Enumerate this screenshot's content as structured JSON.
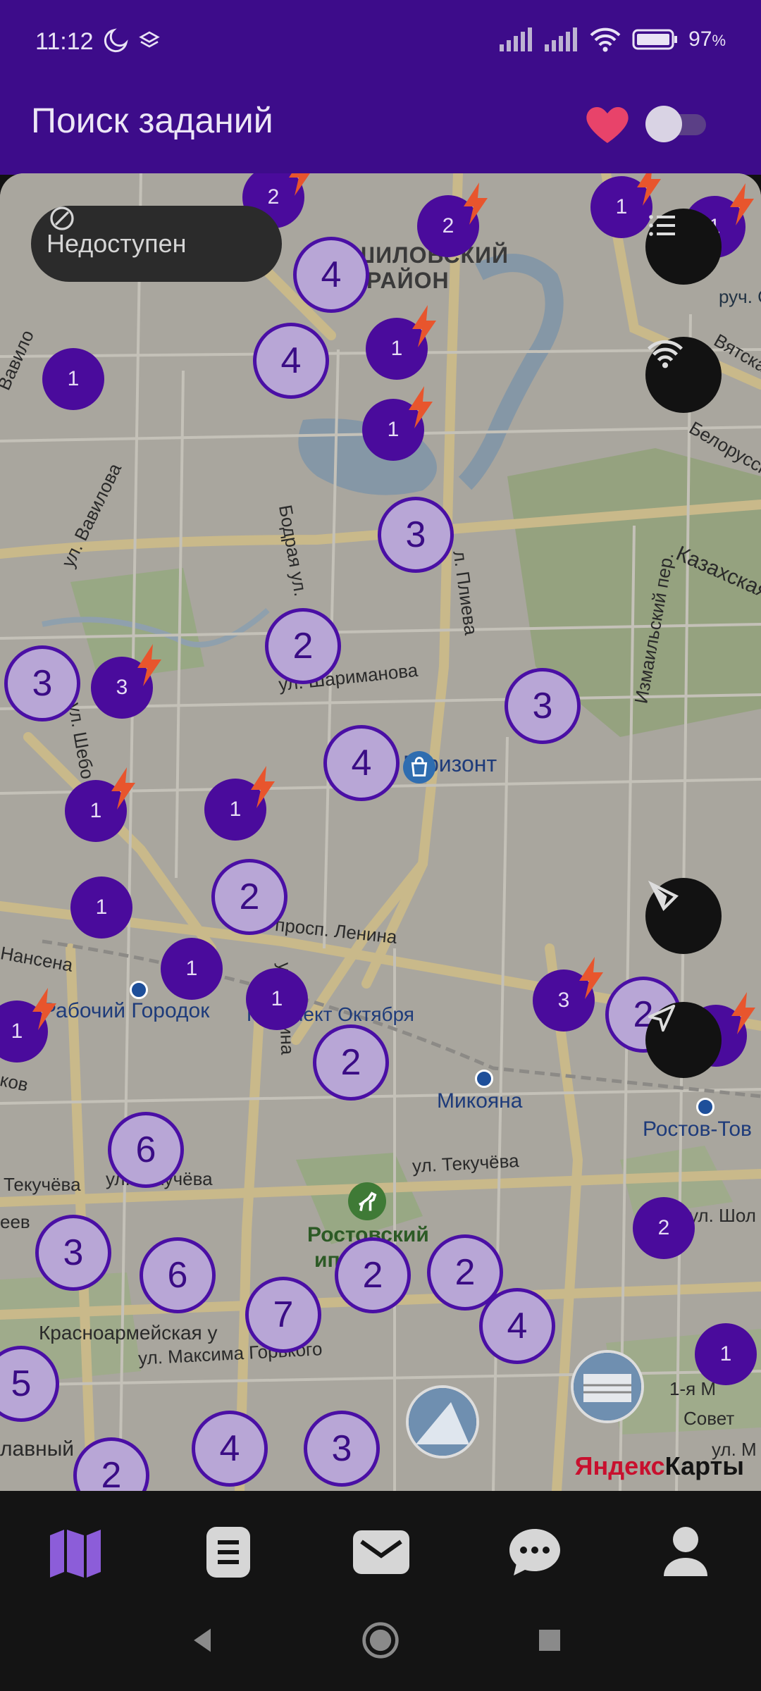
{
  "status_bar": {
    "time": "11:12",
    "battery": "97",
    "battery_unit": "%"
  },
  "app_bar": {
    "title": "Поиск заданий",
    "favorites_icon": "heart-icon",
    "toggle_state": "off"
  },
  "map": {
    "status_pill": "Недоступен",
    "attribution_main": "Яндекс",
    "attribution_sub": "Карты",
    "labels": {
      "district": "ШИЛОВСКИЙ",
      "district2": "РАЙОН",
      "vavilova": "ул. Вавилова",
      "vavilova_top": "Вавило",
      "bodraya": "Бодрая ул.",
      "plieva": "л. Плиева",
      "izmailsky": "Измаильский пер.",
      "kazakhskaya": "Казахская",
      "belorusskaya": "Белорусск",
      "vyatskaya": "Вятска",
      "ruch": "руч. С",
      "krimanova": "ул. Шариманова",
      "gorizont": "Горизонт",
      "shebo": "ул. Шебо",
      "prosp_lenina": "просп. Ленина",
      "nansena": "Нансена",
      "rabochy": "Рабочий Городок",
      "prospekt_oktyabrya": "Проспект Октября",
      "mikoyana": "Микояна",
      "rostov_tov": "Ростов-Тов",
      "rostovsky": "Ростовский",
      "ip": "ип",
      "tekucheva": "ул. Текучёва",
      "tekucheva2": "Текучёва",
      "tekucheva3": "ул. Текучёва",
      "krasnoarm": "Красноармейская у",
      "maksima": "ул. Максима Горького",
      "glavny": "лавный",
      "sholokh": "ул. Шол",
      "first_m": "1-я М",
      "sovet": "Совет",
      "ul_m": "ул. М",
      "eev": "еев",
      "ko": "ков",
      "lenina_v": "ул. Ленина"
    },
    "clusters": [
      {
        "label": "2",
        "kind": "dark",
        "bolt": true
      },
      {
        "label": "2",
        "kind": "dark",
        "bolt": true
      },
      {
        "label": "1",
        "kind": "dark",
        "bolt": true
      },
      {
        "label": "1",
        "kind": "dark",
        "bolt": true
      },
      {
        "label": "4",
        "kind": "light",
        "bolt": false
      },
      {
        "label": "1",
        "kind": "dark",
        "bolt": false
      },
      {
        "label": "4",
        "kind": "light",
        "bolt": false
      },
      {
        "label": "1",
        "kind": "dark",
        "bolt": true
      },
      {
        "label": "1",
        "kind": "dark",
        "bolt": true
      },
      {
        "label": "3",
        "kind": "light",
        "bolt": false
      },
      {
        "label": "2",
        "kind": "light",
        "bolt": false
      },
      {
        "label": "3",
        "kind": "light",
        "bolt": false
      },
      {
        "label": "3",
        "kind": "dark",
        "bolt": true
      },
      {
        "label": "3",
        "kind": "light",
        "bolt": false
      },
      {
        "label": "4",
        "kind": "light",
        "bolt": false
      },
      {
        "label": "1",
        "kind": "dark",
        "bolt": true
      },
      {
        "label": "1",
        "kind": "dark",
        "bolt": true
      },
      {
        "label": "2",
        "kind": "light",
        "bolt": false
      },
      {
        "label": "1",
        "kind": "dark",
        "bolt": false
      },
      {
        "label": "1",
        "kind": "dark",
        "bolt": false
      },
      {
        "label": "1",
        "kind": "dark",
        "bolt": false
      },
      {
        "label": "1",
        "kind": "dark",
        "bolt": true
      },
      {
        "label": "2",
        "kind": "light",
        "bolt": false
      },
      {
        "label": "3",
        "kind": "dark",
        "bolt": true
      },
      {
        "label": "2",
        "kind": "light",
        "bolt": false
      },
      {
        "label": "1",
        "kind": "dark",
        "bolt": true
      },
      {
        "label": "6",
        "kind": "light",
        "bolt": false
      },
      {
        "label": "3",
        "kind": "light",
        "bolt": false
      },
      {
        "label": "6",
        "kind": "light",
        "bolt": false
      },
      {
        "label": "2",
        "kind": "dark",
        "bolt": false
      },
      {
        "label": "7",
        "kind": "light",
        "bolt": false
      },
      {
        "label": "2",
        "kind": "light",
        "bolt": false
      },
      {
        "label": "2",
        "kind": "light",
        "bolt": false
      },
      {
        "label": "4",
        "kind": "light",
        "bolt": false
      },
      {
        "label": "1",
        "kind": "dark",
        "bolt": false
      },
      {
        "label": "5",
        "kind": "light",
        "bolt": false
      },
      {
        "label": "4",
        "kind": "light",
        "bolt": false
      },
      {
        "label": "3",
        "kind": "light",
        "bolt": false
      },
      {
        "label": "2",
        "kind": "light",
        "bolt": false
      }
    ]
  },
  "bottom_nav": {
    "items": [
      {
        "icon": "map-icon",
        "active": true
      },
      {
        "icon": "document-list-icon",
        "active": false
      },
      {
        "icon": "mail-icon",
        "active": false
      },
      {
        "icon": "chat-icon",
        "active": false
      },
      {
        "icon": "profile-icon",
        "active": false
      }
    ]
  },
  "system_nav": {
    "icons": [
      "back-icon",
      "home-icon",
      "recents-icon"
    ]
  },
  "colors": {
    "brand": "#3d0c8a",
    "accent": "#4a0b9c",
    "bolt": "#e8552d",
    "heart": "#e8436a"
  }
}
